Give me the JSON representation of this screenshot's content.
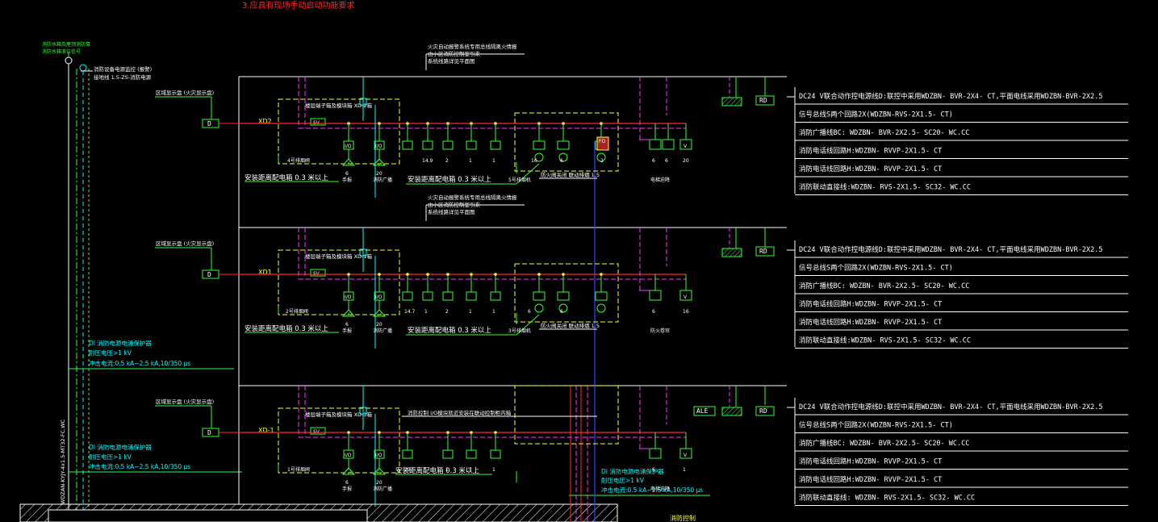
{
  "title": "3.应具有现场手动启动功能要求",
  "top_left_note": [
    "消防水箱及屋顶消防泵",
    "消防水箱液位信号"
  ],
  "main_riser_note": [
    "消防设备电源监控 (报警)",
    "接地线 1.5-ZS-消防电源"
  ],
  "riser_cable": "WDZAN-KYJY-4x1.5-MT32-FC,WC",
  "floors": [
    {
      "id": "XD2",
      "module_label": "区域显示盘 (火灾显示盘)",
      "header_notes": [
        "火灾自动报警系统专用总线隔离火情报",
        "由小区消防控制室引来",
        "系统线路详见平面图"
      ],
      "box_title": "楼层端子箱及模块箱 XD-2箱",
      "install_note": "安装距离配电箱  0.3  米以上",
      "pump_note": "5号排烟机",
      "wire_note": "防火阀关闭 联动排烟 1.5",
      "legend": [
        "DC24 V联合动作控电源线D:联控中采用WDZBN- BVR-2X4- CT,平面电线采用WDZBN-BVR-2X2.5",
        "信号总线S两个回路2X(WDZBN-RVS-2X1.5- CT)",
        "消防广播线BC:     WDZBN- BVR-2X2.5- SC20- WC.CC",
        "消防电话线回路H:WDZBN- RVVP-2X1.5- CT",
        "消防电话线回路H:WDZBN- RVVP-2X1.5- CT",
        "消防联动直接线:WDZBN- RVS-2X1.5- SC32- WC.CC"
      ],
      "counts": [
        "4号排烟阀",
        "6",
        "20",
        "14.9",
        "2",
        "1",
        "1",
        "16",
        "6",
        "2",
        "6",
        "6",
        "20"
      ],
      "count_captions": [
        "手报",
        "消防广播",
        "电梯迫降"
      ]
    },
    {
      "id": "XD1",
      "module_label": "区域显示盘 (火灾显示盘)",
      "header_notes": [
        "火灾自动报警系统专用总线隔离火情报",
        "由小区消防控制室引来",
        "系统线路详见平面图"
      ],
      "box_title": "楼层端子箱及模块箱 XD-1箱",
      "install_note": "安装距离配电箱  0.3  米以上",
      "pump_note": "3号排烟机",
      "wire_note": "防火阀关闭 联动排烟 1.5",
      "legend": [
        "DC24 V联合动作控电源线D:联控中采用WDZBN- BVR-2X4- CT,平面电线采用WDZBN-BVR-2X2.5",
        "信号总线S两个回路2X(WDZBN-RVS-2X1.5- CT)",
        "消防广播线BC:     WDZBN- BVR-2X2.5- SC20- WC.CC",
        "消防电话线回路H:WDZBN- RVVP-2X1.5- CT",
        "消防电话线回路H:WDZBN- RVVP-2X1.5- CT",
        "消防联动直接线:WDZBN- RVS-2X1.5- SC32- WC.CC"
      ],
      "counts": [
        "2号排烟阀",
        "6",
        "20",
        "14.7",
        "1",
        "2",
        "1",
        "1",
        "6",
        "6",
        "6",
        "16"
      ],
      "count_captions": [
        "手报",
        "消防广播",
        "防火卷帘"
      ]
    },
    {
      "id": "XD-1",
      "module_label": "区域显示盘 (火灾显示盘)",
      "header_notes": [],
      "box_title": "楼层端子箱及模块箱 XD-3箱",
      "install_note": "安装距离配电箱  0.3  米以上",
      "pump_note": "",
      "wire_note": "消防控制 I/O模块就近安装在联动控制柜内箱",
      "legend": [
        "DC24 V联合动作控电源线D:联控中采用WDZBN- BVR-2X4- CT,平面电线采用WDZBN-BVR-2X2.5",
        "信号总线S两个回路2X(WDZBN-RVS-2X1.5- CT)",
        "消防广播线BC:     WDZBN- BVR-2X2.5- SC20- WC.CC",
        "消防电话线回路H:WDZBN- RVVP-2X1.5- CT",
        "消防电话线回路H:WDZBN- RVVP-2X1.5- CT",
        "消防联动直接线: WDZBN- RVS-2X1.5- SC32- WC.CC"
      ],
      "counts": [
        "1号排烟阀",
        "6",
        "20",
        "29",
        "1",
        "1",
        "1",
        "6",
        "1"
      ],
      "count_captions": [
        "手报",
        "消防广播",
        "电梯迫降"
      ]
    }
  ],
  "surge1": [
    "DI 消防电源电涌保护器",
    "耐压电压>1 kV",
    "冲击电流:0.5 kA~2.5 kA,10/350 μs"
  ],
  "surge2": [
    "DI 消防电源电涌保护器",
    "耐压电压>1 kV",
    "冲击电流:0.5 kA~2.5 kA,10/350 μs"
  ],
  "surge3": [
    "DI 消防电源电涌保护器",
    "耐压电压>1 kV",
    "冲击电流:0.5 kA~2.5 kA,10/350 μs"
  ],
  "bottom_label": "消防控制",
  "tags": {
    "rd": "RD",
    "ale": "ALE",
    "d": "D",
    "fo": "FO",
    "sv": "SV",
    "io": "I/O",
    "v": "V"
  },
  "colors": {
    "background": "#000000",
    "green": "#33ff33",
    "yellow": "#ffff33",
    "magenta": "#ff33ff",
    "cyan": "#00ffff",
    "red": "#ff2a2a",
    "blue": "#3344ff",
    "white": "#ffffff"
  }
}
